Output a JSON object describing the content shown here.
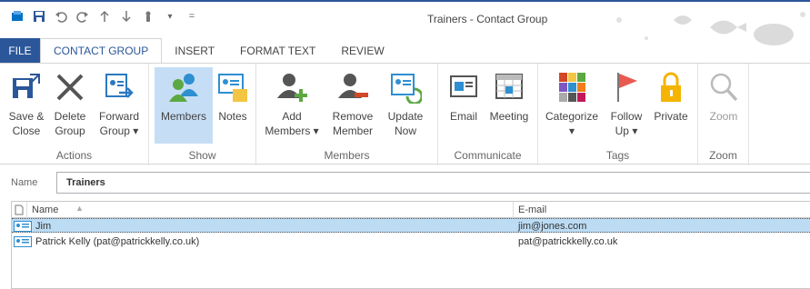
{
  "window": {
    "title": "Trainers - Contact Group"
  },
  "quick_access": [
    {
      "icon": "outlook-icon",
      "glyph": "▣"
    },
    {
      "icon": "save-icon",
      "glyph": "■"
    },
    {
      "icon": "undo-icon",
      "glyph": "↶"
    },
    {
      "icon": "redo-icon",
      "glyph": "↻"
    },
    {
      "icon": "up-arrow-icon",
      "glyph": "↑"
    },
    {
      "icon": "down-arrow-icon",
      "glyph": "↓"
    },
    {
      "icon": "touch-mode-icon",
      "glyph": "☝"
    },
    {
      "icon": "customize-icon",
      "glyph": "▾"
    }
  ],
  "tabs": [
    "FILE",
    "CONTACT GROUP",
    "INSERT",
    "FORMAT TEXT",
    "REVIEW"
  ],
  "ribbon": {
    "actions": {
      "label": "Actions",
      "save_close": "Save &\nClose",
      "delete_group": "Delete\nGroup",
      "forward_group": "Forward\nGroup ▾"
    },
    "show": {
      "label": "Show",
      "members": "Members",
      "notes": "Notes"
    },
    "members": {
      "label": "Members",
      "add_members": "Add\nMembers ▾",
      "remove_member": "Remove\nMember",
      "update_now": "Update\nNow"
    },
    "communicate": {
      "label": "Communicate",
      "email": "Email",
      "meeting": "Meeting"
    },
    "tags": {
      "label": "Tags",
      "categorize": "Categorize\n▾",
      "follow_up": "Follow\nUp ▾",
      "private": "Private"
    },
    "zoom": {
      "label": "Zoom",
      "zoom": "Zoom"
    }
  },
  "name_field": {
    "label": "Name",
    "value": "Trainers"
  },
  "list": {
    "headers": {
      "name": "Name",
      "email": "E-mail"
    },
    "rows": [
      {
        "name": "Jim",
        "email": "jim@jones.com",
        "selected": true
      },
      {
        "name": "Patrick Kelly (pat@patrickkelly.co.uk)",
        "email": "pat@patrickkelly.co.uk",
        "selected": false
      }
    ]
  },
  "colors": {
    "accent": "#2b579a",
    "selected": "#c5def5",
    "row_selected": "#bcdcf4"
  }
}
